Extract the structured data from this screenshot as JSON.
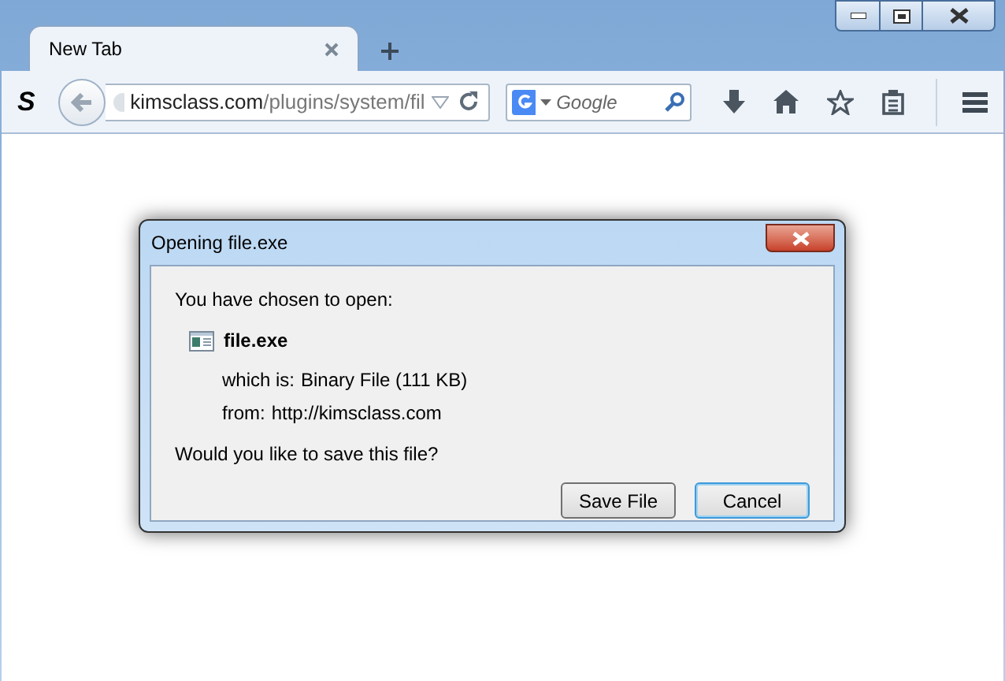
{
  "tabs": [
    {
      "label": "New Tab",
      "selected": true
    }
  ],
  "toolbar": {
    "logo": "S",
    "url": {
      "host": "kimsclass.com",
      "path": "/plugins/system/fil"
    },
    "search": {
      "placeholder": "Google"
    }
  },
  "dialog": {
    "title": "Opening file.exe",
    "intro": "You have chosen to open:",
    "file_name": "file.exe",
    "details": [
      {
        "label": "which is:",
        "value": "Binary File (111 KB)"
      },
      {
        "label": "from:",
        "value": "http://kimsclass.com"
      }
    ],
    "question": "Would you like to save this file?",
    "buttons": [
      {
        "label": "Save File",
        "focused": false
      },
      {
        "label": "Cancel",
        "focused": true
      }
    ]
  }
}
